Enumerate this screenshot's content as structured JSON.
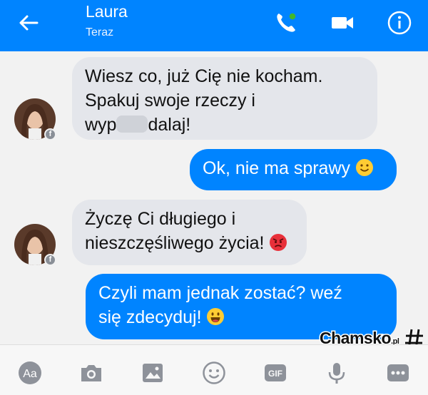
{
  "header": {
    "contact_name": "Laura",
    "status": "Teraz",
    "icons": [
      "back-arrow-icon",
      "phone-icon",
      "video-camera-icon",
      "info-icon"
    ]
  },
  "messages": [
    {
      "from": "contact",
      "lines": [
        "Wiesz co, już Cię nie kocham.",
        "Spakuj swoje rzeczy i"
      ],
      "line3_start": "wyp",
      "line3_end": "dalaj!",
      "censored": true
    },
    {
      "from": "me",
      "text": "Ok, nie ma sprawy",
      "emoji": "smiling-face-icon"
    },
    {
      "from": "contact",
      "lines": [
        "Życzę Ci długiego i"
      ],
      "line2": "nieszczęśliwego życia!",
      "emoji": "angry-face-icon"
    },
    {
      "from": "me",
      "lines": [
        "Czyli mam jednak zostać? weź"
      ],
      "line2": "się zdecyduj!",
      "emoji": "grinning-face-icon"
    }
  ],
  "watermark": {
    "brand": "Chamsko",
    "tld": ".pl"
  },
  "toolbar": {
    "aa_label": "Aa",
    "gif_label": "GIF",
    "icons": [
      "text-aa-icon",
      "camera-icon",
      "gallery-icon",
      "sticker-smiley-icon",
      "gif-icon",
      "microphone-icon",
      "more-icon"
    ]
  },
  "colors": {
    "accent": "#0084ff",
    "incoming_bubble": "#e4e6eb",
    "background": "#f2f2f2"
  }
}
